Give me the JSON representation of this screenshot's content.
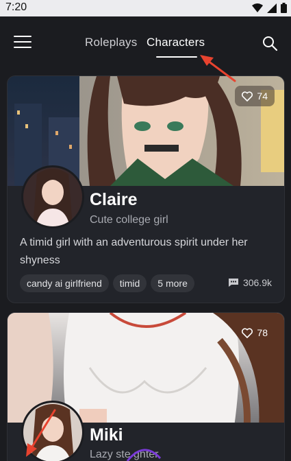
{
  "status_bar": {
    "time": "7:20",
    "icons": [
      "wifi-icon",
      "signal-icon",
      "battery-icon"
    ]
  },
  "header": {
    "tabs": [
      {
        "label": "Roleplays",
        "active": false
      },
      {
        "label": "Characters",
        "active": true
      }
    ],
    "icons": [
      "menu-icon",
      "search-icon"
    ]
  },
  "characters": [
    {
      "name": "Claire",
      "subtitle": "Cute college girl",
      "description": "A timid girl with an adventurous spirit under her shyness",
      "likes": "74",
      "tags": [
        "candy ai girlfriend",
        "timid",
        "5 more"
      ],
      "chats": "306.9k"
    },
    {
      "name": "Miki",
      "subtitle": "Lazy ste   ghter",
      "likes": "78"
    }
  ],
  "colors": {
    "background": "#1b1c20",
    "card": "#22242a",
    "annotation": "#e8432f"
  }
}
